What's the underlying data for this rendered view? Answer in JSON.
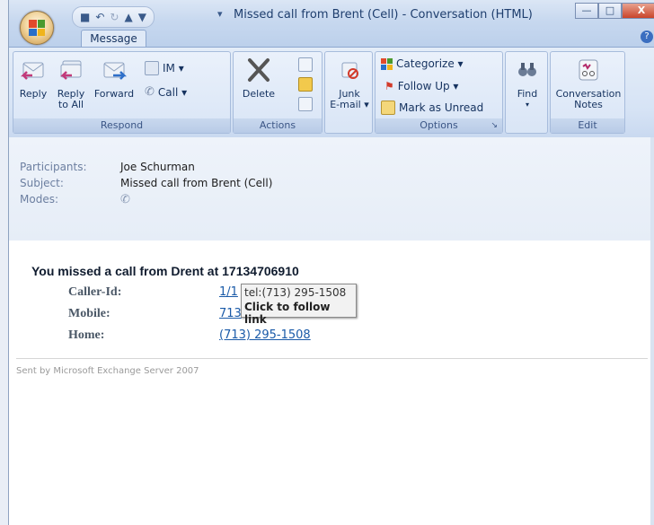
{
  "window": {
    "title": "Missed call from Brent (Cell) - Conversation (HTML)"
  },
  "ribbon": {
    "active_tab": "Message",
    "respond": {
      "label": "Respond",
      "reply": "Reply",
      "reply_all_line1": "Reply",
      "reply_all_line2": "to All",
      "forward": "Forward",
      "im": "IM ▾",
      "call": "Call ▾"
    },
    "actions": {
      "label": "Actions",
      "delete": "Delete"
    },
    "junk": {
      "line1": "Junk",
      "line2": "E-mail ▾"
    },
    "options": {
      "label": "Options",
      "categorize": "Categorize ▾",
      "follow_up": "Follow Up ▾",
      "mark_unread": "Mark as Unread"
    },
    "find": {
      "label": "Find"
    },
    "edit": {
      "label": "Edit",
      "notes_line1": "Conversation",
      "notes_line2": "Notes"
    }
  },
  "header": {
    "participants_label": "Participants:",
    "participants_value": "Joe Schurman",
    "subject_label": "Subject:",
    "subject_value": "Missed call from Brent (Cell)",
    "modes_label": "Modes:"
  },
  "message": {
    "heading": "You missed a call from Drent at 17134706910",
    "rows": [
      {
        "label": "Caller-Id:",
        "link": "1/1"
      },
      {
        "label": "Mobile:",
        "link": "713"
      },
      {
        "label": "Home:",
        "link": "(713) 295-1508"
      }
    ],
    "tooltip": {
      "url": "tel:(713) 295-1508",
      "hint": "Click to follow link"
    },
    "footer": "Sent by Microsoft Exchange Server 2007"
  },
  "colors": {
    "link": "#1a5aa8",
    "ribbon_bg": "#d6e3f5",
    "header_bg": "#e9eff8"
  }
}
